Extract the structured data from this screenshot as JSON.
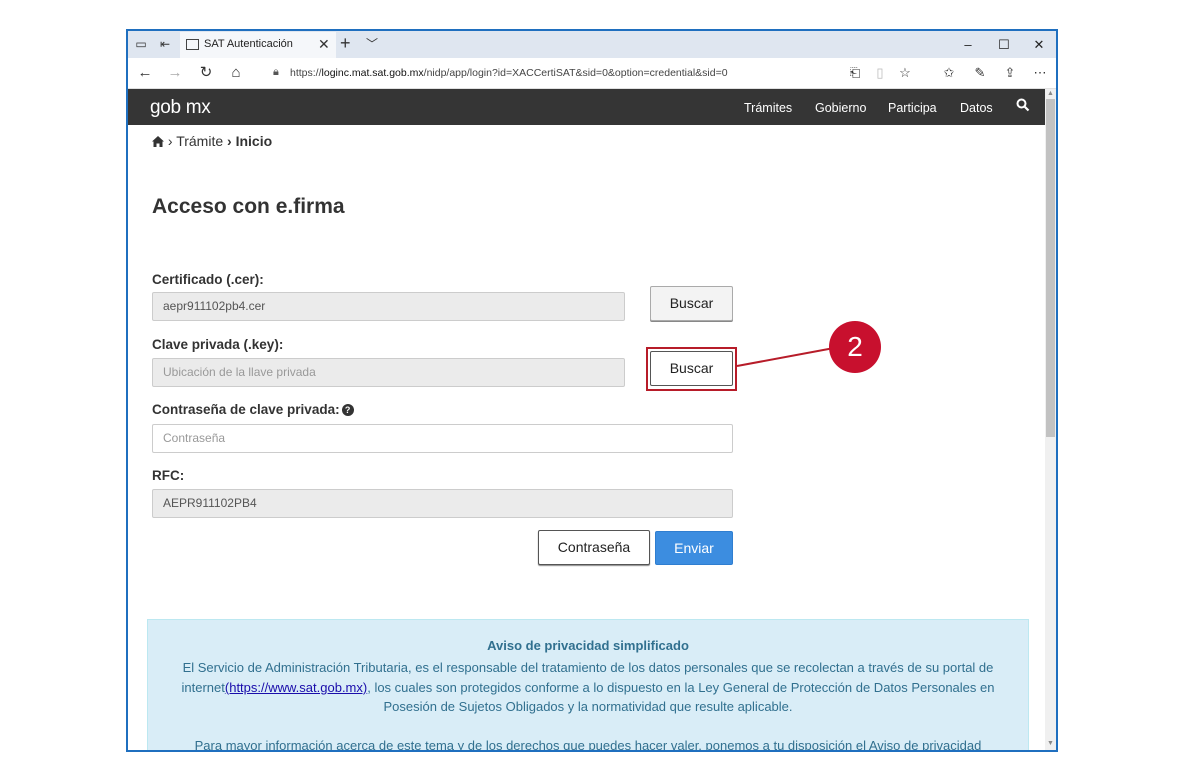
{
  "browser": {
    "tab_title": "SAT Autenticación",
    "tab_close": "✕",
    "new_tab": "+",
    "tab_menu": "﹀",
    "url_prefix": "https://",
    "url_host": "loginc.mat.sat.gob.mx",
    "url_path": "/nidp/app/login?id=XACCertiSAT&sid=0&option=credential&sid=0",
    "controls": {
      "minimize": "–",
      "maximize": "☐",
      "close": "✕"
    }
  },
  "site": {
    "logo": "gob mx",
    "nav": [
      "Trámites",
      "Gobierno",
      "Participa",
      "Datos"
    ]
  },
  "breadcrumb": {
    "home_sep": "›",
    "tramite": "Trámite",
    "sep": "›",
    "current": "Inicio"
  },
  "page_title": "Acceso con e.firma",
  "form": {
    "cer_label": "Certificado (.cer):",
    "cer_value": "aepr911102pb4.cer",
    "cer_button": "Buscar",
    "key_label": "Clave privada (.key):",
    "key_placeholder": "Ubicación de la llave privada",
    "key_button": "Buscar",
    "password_label": "Contraseña de clave privada:",
    "password_help": "?",
    "password_placeholder": "Contraseña",
    "rfc_label": "RFC:",
    "rfc_value": "AEPR911102PB4",
    "btn_password": "Contraseña",
    "btn_submit": "Enviar"
  },
  "callout": {
    "number": "2",
    "color": "#c8102e"
  },
  "privacy": {
    "title": "Aviso de privacidad simplificado",
    "p1_a": "El Servicio de Administración Tributaria, es el responsable del tratamiento de los datos personales que se recolectan a través de su portal de internet",
    "p1_link": "(https://www.sat.gob.mx)",
    "p1_b": ", los cuales son protegidos conforme a lo dispuesto en la Ley General de Protección de Datos Personales en Posesión de Sujetos Obligados y la normatividad que resulte aplicable.",
    "p2": "Para mayor información acerca de este tema y de los derechos que puedes hacer valer, ponemos a tu disposición el Aviso de privacidad"
  },
  "colors": {
    "accent": "#3c8de0",
    "navbar": "#353535",
    "privacy_bg": "#d9edf7",
    "highlight": "#b71c29"
  }
}
